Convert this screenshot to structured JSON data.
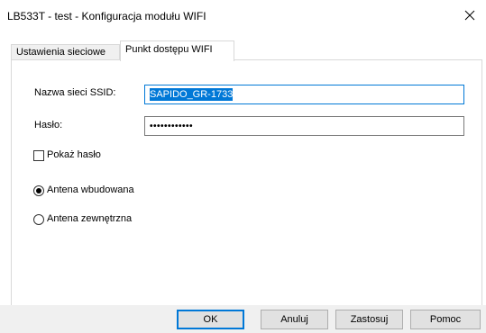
{
  "window": {
    "title": "LB533T - test - Konfiguracja modułu WIFI",
    "close_glyph": "✕"
  },
  "tabs": [
    {
      "label": "Ustawienia sieciowe",
      "active": false
    },
    {
      "label": "Punkt dostępu WIFI",
      "active": true
    }
  ],
  "form": {
    "ssid_label": "Nazwa sieci SSID:",
    "ssid_value": "SAPIDO_GR-1733",
    "password_label": "Hasło:",
    "password_value": "••••••••••••",
    "show_password_label": "Pokaż hasło",
    "show_password_checked": false,
    "antenna_internal_label": "Antena wbudowana",
    "antenna_internal_selected": true,
    "antenna_external_label": "Antena zewnętrzna",
    "antenna_external_selected": false
  },
  "buttons": {
    "ok": "OK",
    "cancel": "Anuluj",
    "apply": "Zastosuj",
    "help": "Pomoc"
  },
  "colors": {
    "accent": "#0078d7",
    "footer_bg": "#f0f0f0"
  },
  "icons": {
    "close": "close-icon"
  }
}
